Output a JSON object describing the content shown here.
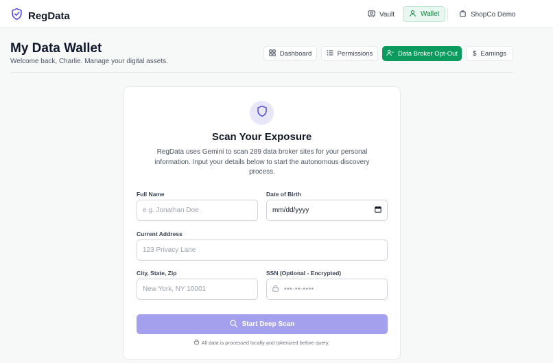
{
  "app": {
    "name": "RegData"
  },
  "nav": {
    "vault": "Vault",
    "wallet": "Wallet",
    "shop": "ShopCo Demo"
  },
  "header": {
    "title": "My Data Wallet",
    "subtitle": "Welcome back, Charlie. Manage your digital assets."
  },
  "tabs": [
    {
      "label": "Dashboard",
      "icon": "grid-icon"
    },
    {
      "label": "Permissions",
      "icon": "list-icon"
    },
    {
      "label": "Data Broker Opt-Out",
      "icon": "user-minus-icon",
      "active": true
    },
    {
      "label": "Earnings",
      "icon": "dollar-icon"
    }
  ],
  "scan": {
    "title": "Scan Your Exposure",
    "description": "RegData uses Gemini to scan 289 data broker sites for your personal information. Input your details below to start the autonomous discovery process.",
    "fields": {
      "full_name": {
        "label": "Full Name",
        "placeholder": "e.g. Jonathan Doe"
      },
      "dob": {
        "label": "Date of Birth",
        "value": "mm/dd/yyyy"
      },
      "address": {
        "label": "Current Address",
        "placeholder": "123 Privacy Lane"
      },
      "city": {
        "label": "City, State, Zip",
        "placeholder": "New York, NY 10001"
      },
      "ssn": {
        "label": "SSN (Optional - Encrypted)",
        "placeholder": "•••-••-••••"
      }
    },
    "button": "Start Deep Scan",
    "footnote": "All data is processed locally and tokenized before query."
  },
  "colors": {
    "accent": "#0b9b5e",
    "scan_button": "#a5a0ee",
    "wallet_active_bg": "#e8f7ef"
  }
}
